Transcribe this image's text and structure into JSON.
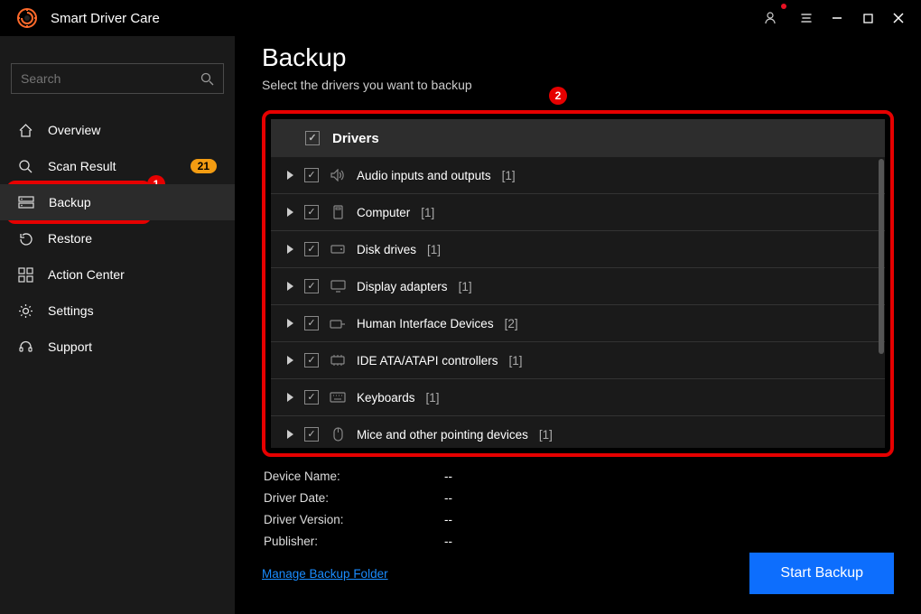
{
  "app": {
    "title": "Smart Driver Care"
  },
  "search": {
    "placeholder": "Search"
  },
  "sidebar": {
    "items": [
      {
        "label": "Overview"
      },
      {
        "label": "Scan Result",
        "badge": "21"
      },
      {
        "label": "Backup"
      },
      {
        "label": "Restore"
      },
      {
        "label": "Action Center"
      },
      {
        "label": "Settings"
      },
      {
        "label": "Support"
      }
    ]
  },
  "page": {
    "title": "Backup",
    "subtitle": "Select the drivers you want to backup"
  },
  "drivers": {
    "header": "Drivers",
    "items": [
      {
        "label": "Audio inputs and outputs",
        "count": "[1]"
      },
      {
        "label": "Computer",
        "count": "[1]"
      },
      {
        "label": "Disk drives",
        "count": "[1]"
      },
      {
        "label": "Display adapters",
        "count": "[1]"
      },
      {
        "label": "Human Interface Devices",
        "count": "[2]"
      },
      {
        "label": "IDE ATA/ATAPI controllers",
        "count": "[1]"
      },
      {
        "label": "Keyboards",
        "count": "[1]"
      },
      {
        "label": "Mice and other pointing devices",
        "count": "[1]"
      }
    ]
  },
  "details": {
    "deviceName": {
      "label": "Device Name:",
      "value": "--"
    },
    "driverDate": {
      "label": "Driver Date:",
      "value": "--"
    },
    "driverVersion": {
      "label": "Driver Version:",
      "value": "--"
    },
    "publisher": {
      "label": "Publisher:",
      "value": "--"
    }
  },
  "footer": {
    "manage": "Manage Backup Folder",
    "start": "Start Backup"
  },
  "callouts": {
    "one": "1",
    "two": "2"
  }
}
